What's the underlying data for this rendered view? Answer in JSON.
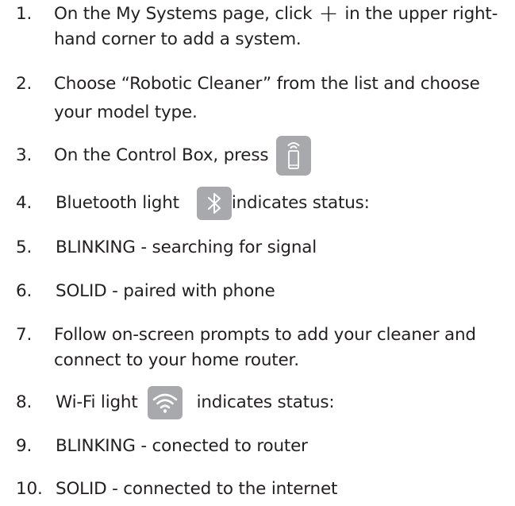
{
  "steps": [
    {
      "number": "1.",
      "line1_before": "On the My Systems page, click",
      "plus_symbol": "+",
      "line1_after": "in the upper right-",
      "line2": "hand corner to add a system."
    },
    {
      "number": "2.",
      "line1": "Choose “Robotic Cleaner” from the list and choose",
      "line2": "your model type."
    },
    {
      "number": "3.",
      "text": "On the Control Box, press",
      "icon": "phone-signal-icon"
    },
    {
      "number": "4.",
      "text_before": "Bluetooth light",
      "icon": "bluetooth-icon",
      "text_after": "indicates status:"
    },
    {
      "number": "5.",
      "text": "BLINKING - searching for signal"
    },
    {
      "number": "6.",
      "text": "SOLID - paired with phone"
    },
    {
      "number": "7.",
      "line1": "Follow on-screen prompts to add your cleaner and",
      "line2": "connect to your home router."
    },
    {
      "number": "8.",
      "text_before": "Wi-Fi light",
      "icon": "wifi-icon",
      "text_after": "indicates status:"
    },
    {
      "number": "9.",
      "text": "BLINKING - conected to router"
    },
    {
      "number": "10.",
      "text": "SOLID - connected to the internet"
    }
  ],
  "colors": {
    "text": "#231f20",
    "icon_background": "#a7a9ac",
    "icon_foreground": "#ffffff"
  }
}
